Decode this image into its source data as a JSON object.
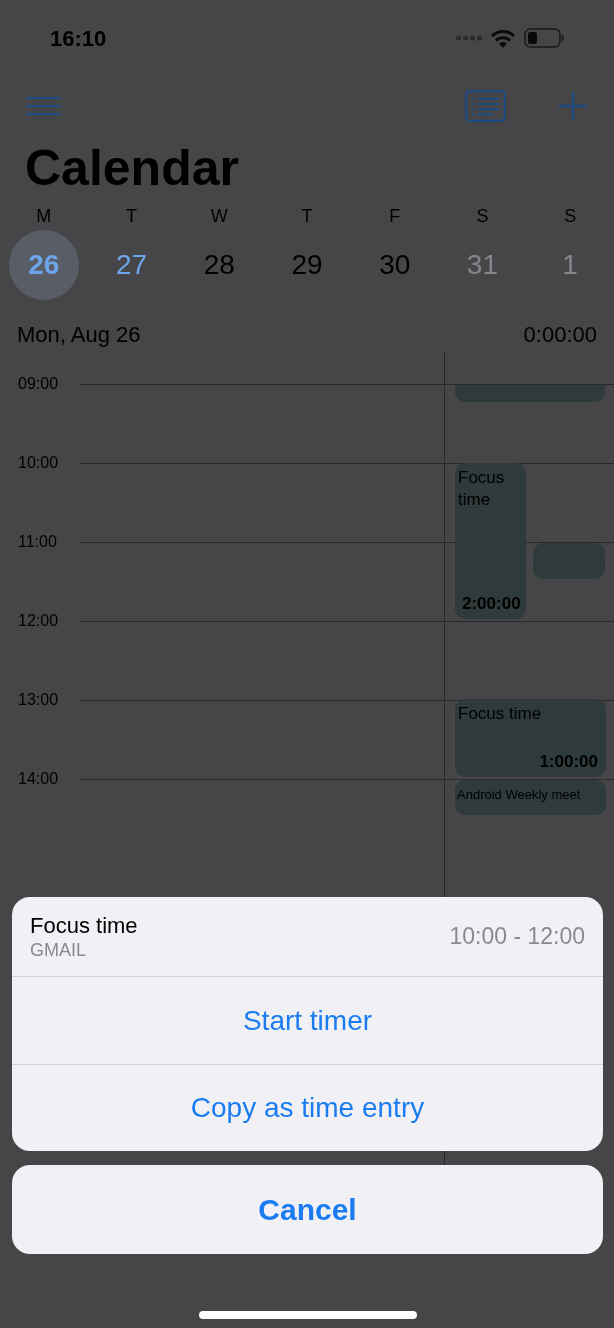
{
  "status_bar": {
    "time": "16:10"
  },
  "title": "Calendar",
  "week": [
    {
      "weekday": "M",
      "day": "26",
      "selected": true,
      "accent": true,
      "weekend": false
    },
    {
      "weekday": "T",
      "day": "27",
      "selected": false,
      "accent": true,
      "weekend": false
    },
    {
      "weekday": "W",
      "day": "28",
      "selected": false,
      "accent": false,
      "weekend": false
    },
    {
      "weekday": "T",
      "day": "29",
      "selected": false,
      "accent": false,
      "weekend": false
    },
    {
      "weekday": "F",
      "day": "30",
      "selected": false,
      "accent": false,
      "weekend": false
    },
    {
      "weekday": "S",
      "day": "31",
      "selected": false,
      "accent": false,
      "weekend": true
    },
    {
      "weekday": "S",
      "day": "1",
      "selected": false,
      "accent": false,
      "weekend": true
    }
  ],
  "date_label": "Mon, Aug 26",
  "day_total": "0:00:00",
  "hours": [
    "09:00",
    "10:00",
    "11:00",
    "12:00",
    "13:00",
    "14:00"
  ],
  "events": [
    {
      "title": "Focus time",
      "duration": "2:00:00"
    },
    {
      "title": "Focus time",
      "duration": "1:00:00"
    },
    {
      "title": "Android Weekly meet"
    }
  ],
  "action_sheet": {
    "title": "Focus time",
    "source": "GMAIL",
    "time_range": "10:00 - 12:00",
    "actions": [
      "Start timer",
      "Copy as time entry"
    ],
    "cancel": "Cancel"
  }
}
